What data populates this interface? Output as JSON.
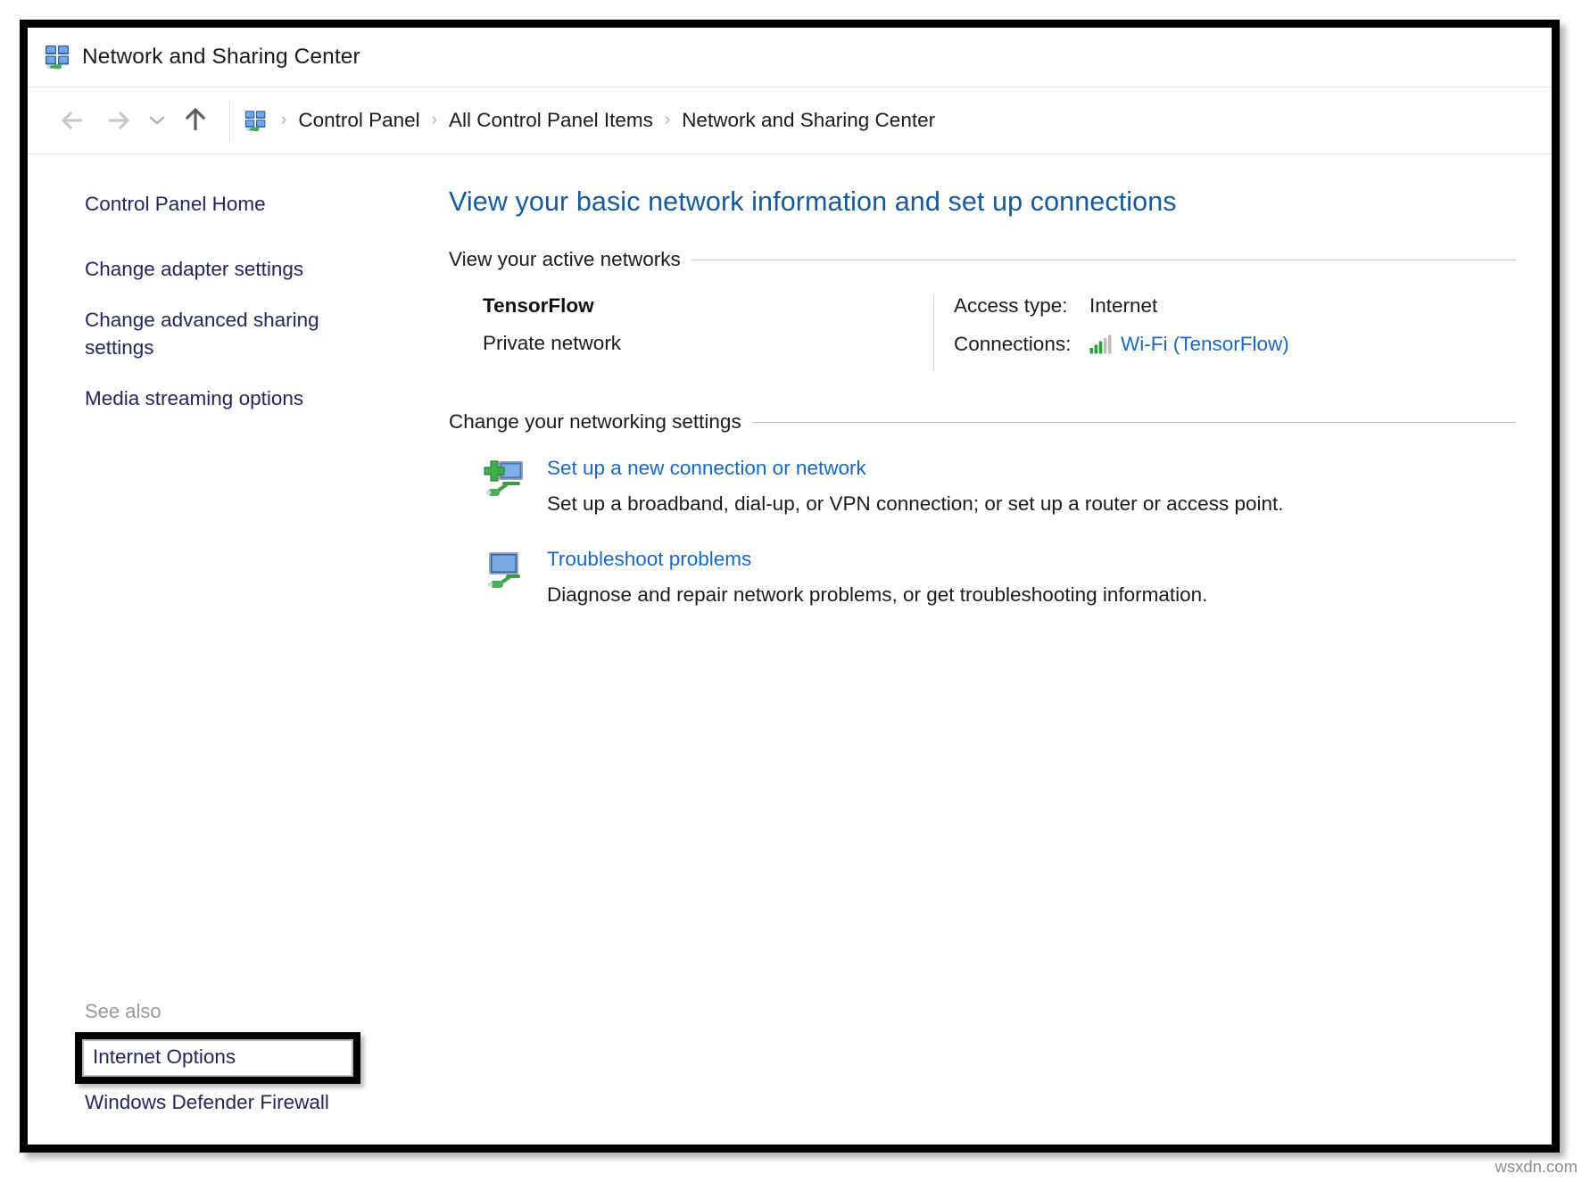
{
  "window": {
    "title": "Network and Sharing Center",
    "title_icon": "network-sharing-icon"
  },
  "addressbar": {
    "back_icon": "arrow-left-icon",
    "forward_icon": "arrow-right-icon",
    "recent_icon": "chevron-down-icon",
    "up_icon": "arrow-up-icon",
    "path_icon": "network-sharing-icon",
    "separator": "›",
    "crumbs": [
      {
        "label": "Control Panel"
      },
      {
        "label": "All Control Panel Items"
      },
      {
        "label": "Network and Sharing Center"
      }
    ]
  },
  "sidebar": {
    "items": [
      {
        "label": "Control Panel Home"
      },
      {
        "label": "Change adapter settings"
      },
      {
        "label": "Change advanced sharing settings"
      },
      {
        "label": "Media streaming options"
      }
    ],
    "see_also": {
      "heading": "See also",
      "highlighted_item": "Internet Options",
      "items": [
        {
          "label": "Windows Defender Firewall"
        }
      ]
    }
  },
  "main": {
    "page_title": "View your basic network information and set up connections",
    "sections": [
      {
        "heading": "View your active networks"
      },
      {
        "heading": "Change your networking settings"
      }
    ],
    "active_network": {
      "name": "TensorFlow",
      "type": "Private network",
      "access_type_label": "Access type:",
      "access_type_value": "Internet",
      "connections_label": "Connections:",
      "connections_link": "Wi-Fi (TensorFlow)",
      "connections_icon": "wifi-signal-icon"
    },
    "tasks": [
      {
        "icon": "new-connection-icon",
        "link": "Set up a new connection or network",
        "description": "Set up a broadband, dial-up, or VPN connection; or set up a router or access point."
      },
      {
        "icon": "troubleshoot-icon",
        "link": "Troubleshoot problems",
        "description": "Diagnose and repair network problems, or get troubleshooting information."
      }
    ]
  },
  "watermark": "wsxdn.com",
  "colors": {
    "title_blue": "#16599c",
    "link_blue": "#1768c4",
    "sidebar_navy": "#22265c",
    "signal_green": "#2e9b3c",
    "signal_gray": "#b6b6b6"
  }
}
